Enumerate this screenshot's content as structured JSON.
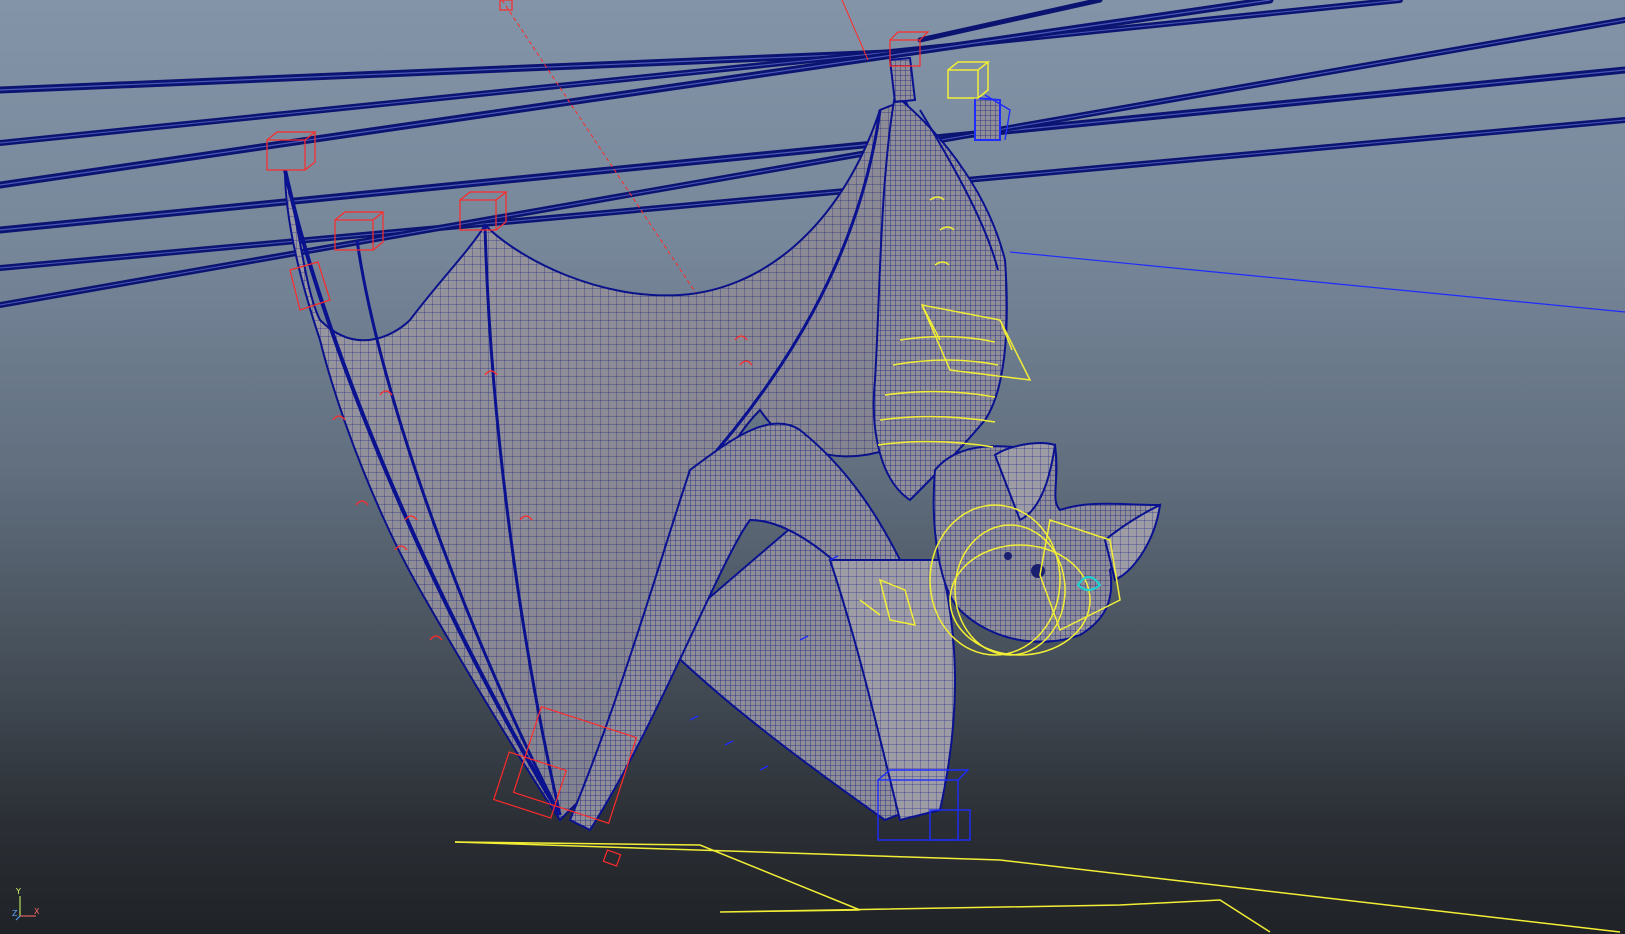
{
  "viewport": {
    "axis_gizmo": {
      "y_label": "Y",
      "x_label": "X",
      "z_label": "Z"
    }
  },
  "colors": {
    "background_top": "#8494a8",
    "background_bottom": "#1f2226",
    "mesh_wire": "#0c1490",
    "mesh_fill": "#9e9da6",
    "rig_fk_control": "#ff2a2a",
    "rig_ik_control": "#f2ee36",
    "rig_secondary_control": "#1e2cff",
    "selection_accent": "#19d2d2"
  },
  "icons": {
    "axis": "axis-gizmo-icon"
  }
}
